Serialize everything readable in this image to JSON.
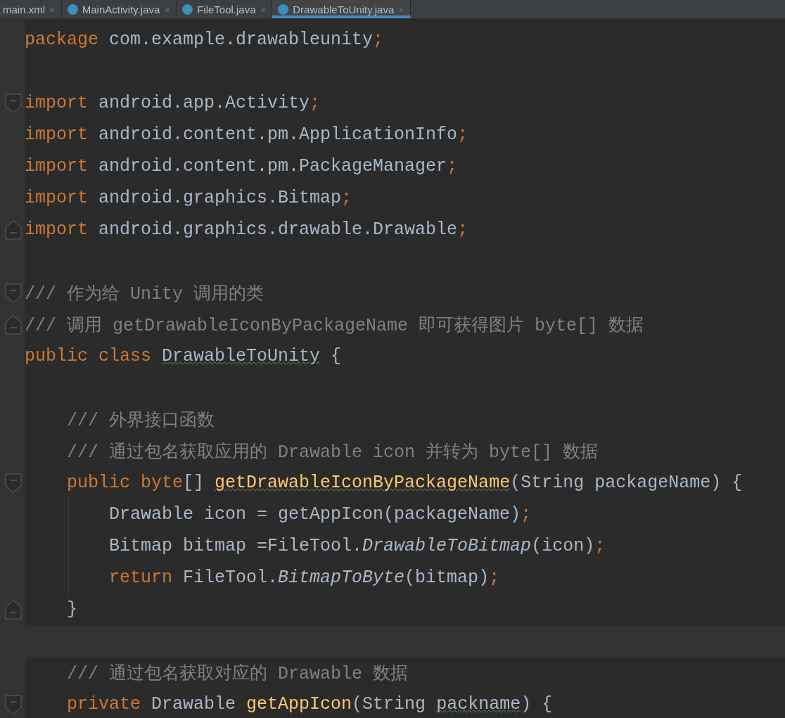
{
  "tabs": [
    {
      "label": "main.xml",
      "icon": false,
      "selected": false,
      "close": "×"
    },
    {
      "label": "MainActivity.java",
      "icon": true,
      "selected": false,
      "close": "×"
    },
    {
      "label": "FileTool.java",
      "icon": true,
      "selected": false,
      "close": "×"
    },
    {
      "label": "DrawableToUnity.java",
      "icon": true,
      "selected": true,
      "close": "×"
    }
  ],
  "editor": {
    "lines": [
      {
        "tokens": [
          {
            "kind": "keyword",
            "text": "package "
          },
          {
            "kind": "plain",
            "text": "com.example.drawableunity"
          },
          {
            "kind": "keyword",
            "text": ";"
          }
        ]
      },
      {
        "gap_before": true,
        "fold_open": true,
        "tokens": [
          {
            "kind": "keyword",
            "text": "import "
          },
          {
            "kind": "plain",
            "text": "android.app.Activity"
          },
          {
            "kind": "keyword",
            "text": ";"
          }
        ]
      },
      {
        "tokens": [
          {
            "kind": "keyword",
            "text": "import "
          },
          {
            "kind": "plain",
            "text": "android.content.pm.ApplicationInfo"
          },
          {
            "kind": "keyword",
            "text": ";"
          }
        ]
      },
      {
        "tokens": [
          {
            "kind": "keyword",
            "text": "import "
          },
          {
            "kind": "plain",
            "text": "android.content.pm.PackageManager"
          },
          {
            "kind": "keyword",
            "text": ";"
          }
        ]
      },
      {
        "tokens": [
          {
            "kind": "keyword",
            "text": "import "
          },
          {
            "kind": "plain",
            "text": "android.graphics.Bitmap"
          },
          {
            "kind": "keyword",
            "text": ";"
          }
        ]
      },
      {
        "fold_close": true,
        "tokens": [
          {
            "kind": "keyword",
            "text": "import "
          },
          {
            "kind": "plain",
            "text": "android.graphics.drawable.Drawable"
          },
          {
            "kind": "keyword",
            "text": ";"
          }
        ]
      },
      {
        "gap_before": true,
        "fold_open": true,
        "tokens": [
          {
            "kind": "comment",
            "text": "/// 作为给 Unity 调用的类"
          }
        ]
      },
      {
        "fold_close": true,
        "tokens": [
          {
            "kind": "comment",
            "text": "/// 调用 getDrawableIconByPackageName 即可获得图片 byte[] 数据"
          }
        ]
      },
      {
        "tokens": [
          {
            "kind": "keyword",
            "text": "public class "
          },
          {
            "kind": "typo",
            "text": "DrawableToUnity"
          },
          {
            "kind": "plain",
            "text": " {"
          }
        ]
      },
      {
        "gap_before": true,
        "tokens": [
          {
            "kind": "comment",
            "text": "    /// 外界接口函数"
          }
        ]
      },
      {
        "tokens": [
          {
            "kind": "comment",
            "text": "    /// 通过包名获取应用的 Drawable icon 并转为 byte[] 数据"
          }
        ]
      },
      {
        "fold_open": true,
        "tokens": [
          {
            "kind": "keyword",
            "text": "    public byte"
          },
          {
            "kind": "plain",
            "text": "[] "
          },
          {
            "kind": "typo-decl",
            "text": "getDrawableIconByPackageName"
          },
          {
            "kind": "plain",
            "text": "(String packageName) {"
          }
        ]
      },
      {
        "guide": true,
        "tokens": [
          {
            "kind": "plain",
            "text": "        Drawable icon = getAppIcon(packageName)"
          },
          {
            "kind": "keyword",
            "text": ";"
          }
        ]
      },
      {
        "guide": true,
        "tokens": [
          {
            "kind": "plain",
            "text": "        Bitmap bitmap =FileTool."
          },
          {
            "kind": "static",
            "text": "DrawableToBitmap"
          },
          {
            "kind": "plain",
            "text": "(icon)"
          },
          {
            "kind": "keyword",
            "text": ";"
          }
        ]
      },
      {
        "guide": true,
        "tokens": [
          {
            "kind": "keyword",
            "text": "        return "
          },
          {
            "kind": "plain",
            "text": "FileTool."
          },
          {
            "kind": "static",
            "text": "BitmapToByte"
          },
          {
            "kind": "plain",
            "text": "(bitmap)"
          },
          {
            "kind": "keyword",
            "text": ";"
          }
        ]
      },
      {
        "fold_close": true,
        "tokens": [
          {
            "kind": "plain",
            "text": "    }"
          }
        ]
      },
      {
        "current": true
      },
      {
        "tokens": [
          {
            "kind": "comment",
            "text": "    /// 通过包名获取对应的 Drawable 数据"
          }
        ]
      },
      {
        "fold_open": true,
        "tokens": [
          {
            "kind": "keyword",
            "text": "    private "
          },
          {
            "kind": "plain",
            "text": "Drawable "
          },
          {
            "kind": "decl",
            "text": "getAppIcon"
          },
          {
            "kind": "plain",
            "text": "(String "
          },
          {
            "kind": "typo",
            "text": "packname"
          },
          {
            "kind": "plain",
            "text": ") {"
          }
        ]
      }
    ]
  }
}
